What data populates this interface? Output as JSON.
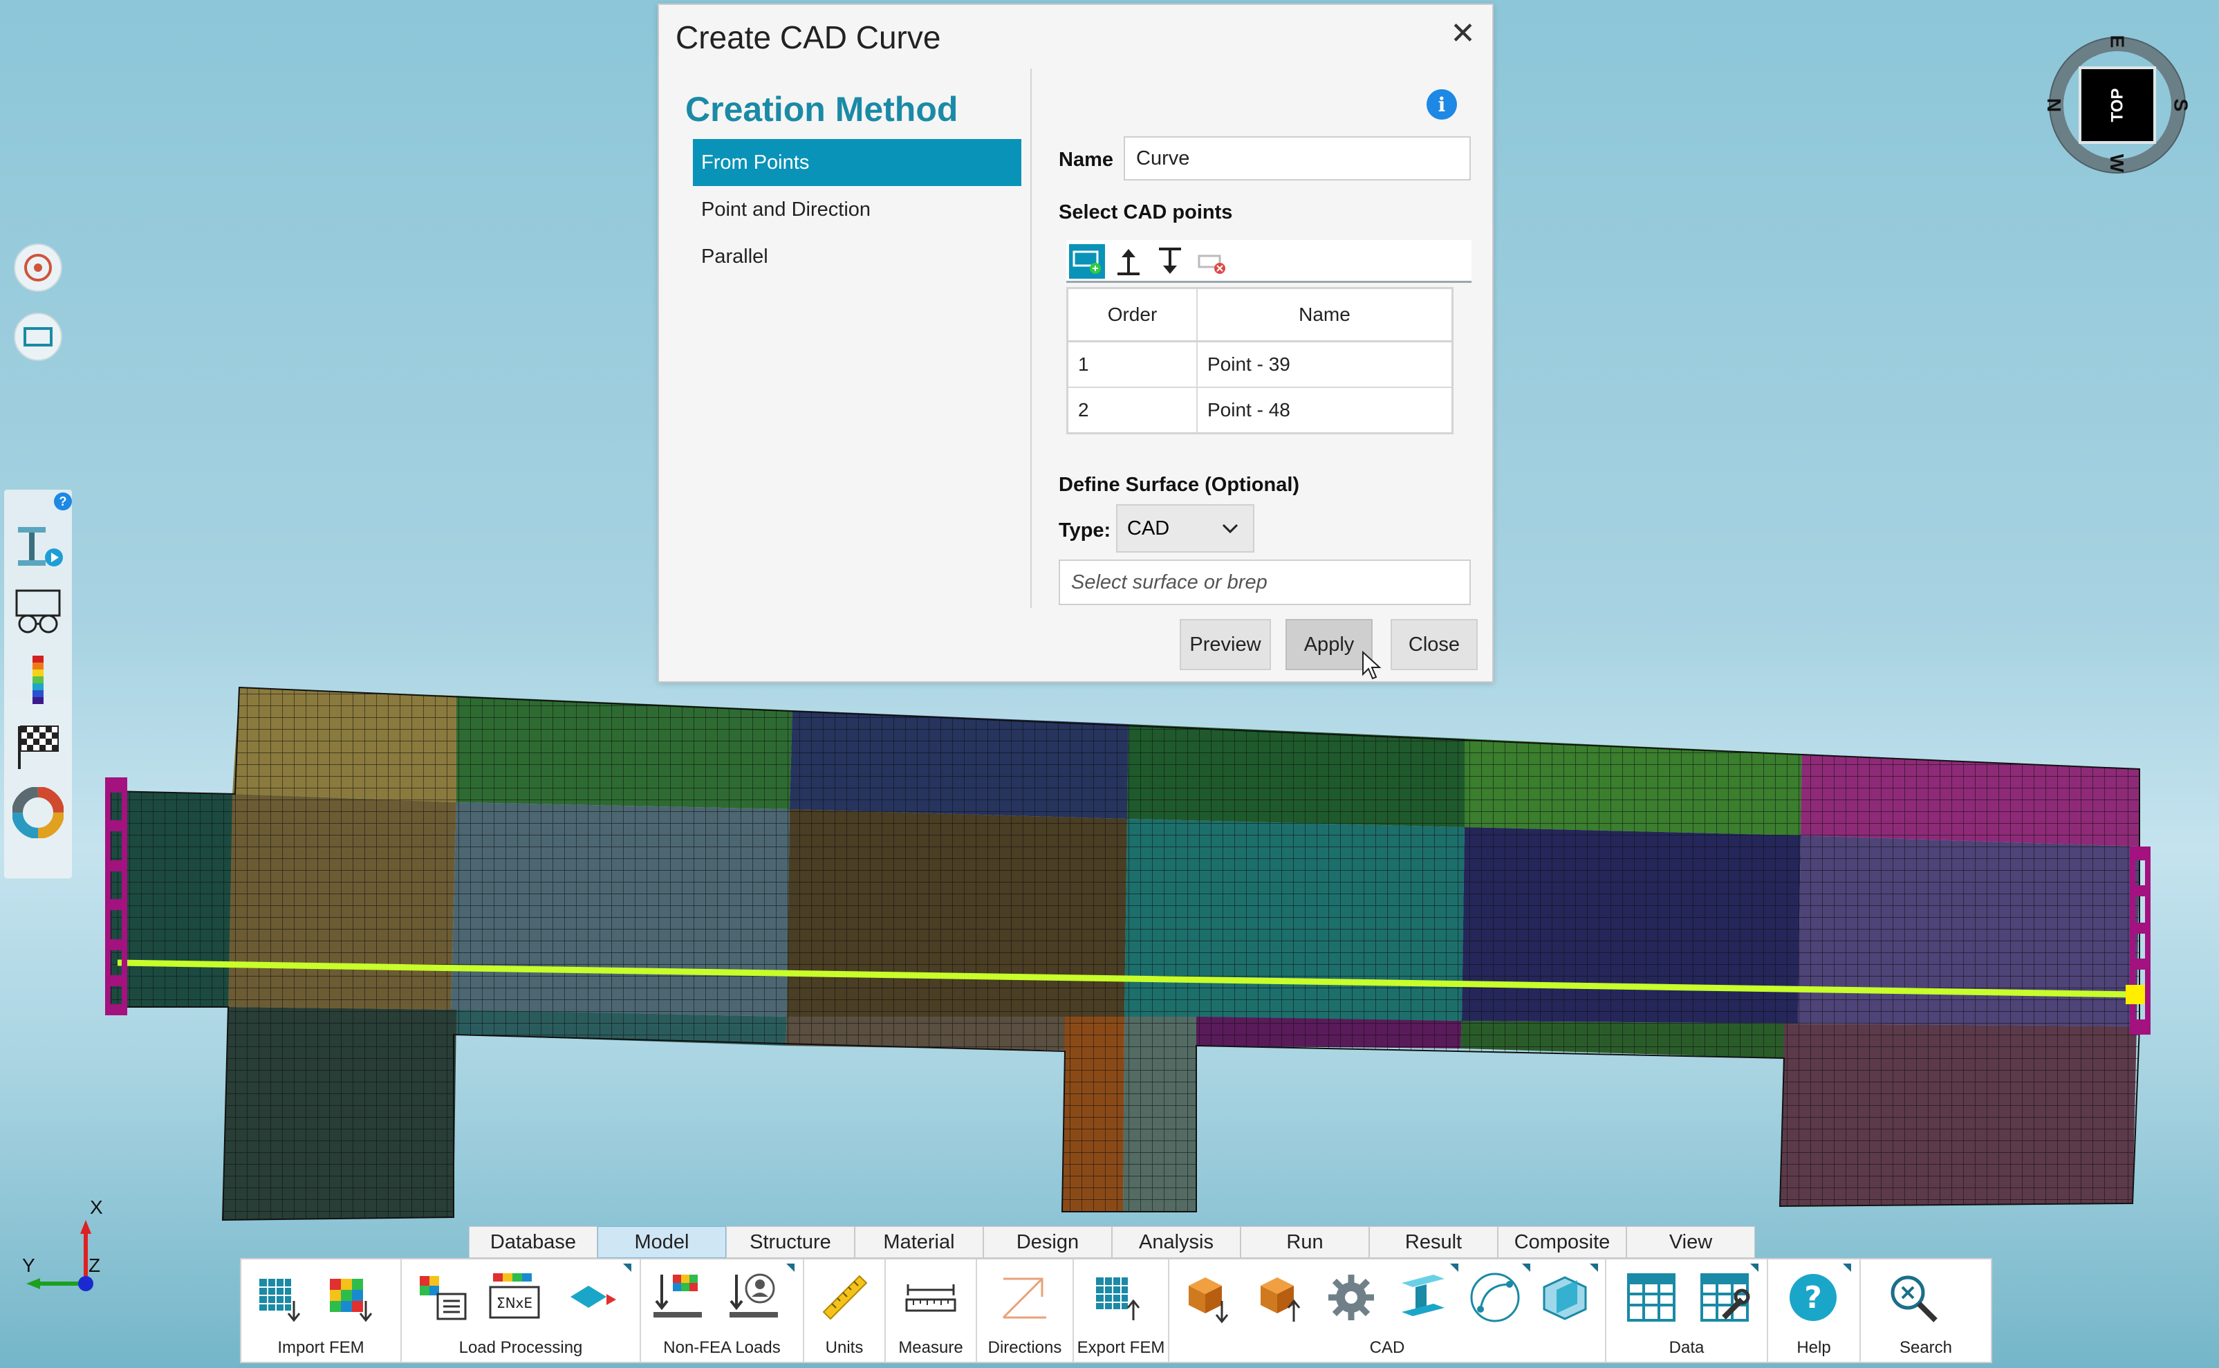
{
  "dialog": {
    "title": "Create CAD Curve",
    "close_glyph": "✕",
    "creation_method_title": "Creation Method",
    "methods": [
      {
        "label": "From Points",
        "active": true
      },
      {
        "label": "Point and Direction",
        "active": false
      },
      {
        "label": "Parallel",
        "active": false
      }
    ],
    "info_glyph": "i",
    "name_label": "Name",
    "name_value": "Curve",
    "select_points_label": "Select CAD points",
    "table": {
      "headers": [
        "Order",
        "Name"
      ],
      "rows": [
        {
          "order": "1",
          "name": "Point - 39"
        },
        {
          "order": "2",
          "name": "Point - 48"
        }
      ]
    },
    "define_surface_label": "Define Surface (Optional)",
    "type_label": "Type:",
    "type_value": "CAD",
    "surface_placeholder": "Select surface or brep",
    "buttons": {
      "preview": "Preview",
      "apply": "Apply",
      "close": "Close"
    }
  },
  "compass": {
    "top_label": "TOP",
    "n": "N",
    "e": "E",
    "s": "S",
    "w": "W"
  },
  "axes": {
    "x": "X",
    "y": "Y",
    "z": "Z"
  },
  "ribbon": {
    "tabs": [
      "Database",
      "Model",
      "Structure",
      "Material",
      "Design",
      "Analysis",
      "Run",
      "Result",
      "Composite",
      "View"
    ],
    "active_tab": "Model",
    "groups": [
      {
        "label": "Import FEM"
      },
      {
        "label": "Load Processing"
      },
      {
        "label": "Non-FEA Loads"
      },
      {
        "label": "Units"
      },
      {
        "label": "Measure"
      },
      {
        "label": "Directions"
      },
      {
        "label": "Export FEM"
      },
      {
        "label": "CAD"
      },
      {
        "label": "Data"
      },
      {
        "label": "Help"
      },
      {
        "label": "Search"
      }
    ]
  },
  "left_toolbar": {
    "help_glyph": "?"
  },
  "colors": {
    "accent": "#0a93b8",
    "curve": "#c8ff2a",
    "edge_marker": "#a3127f",
    "point_marker": "#ffee00"
  }
}
